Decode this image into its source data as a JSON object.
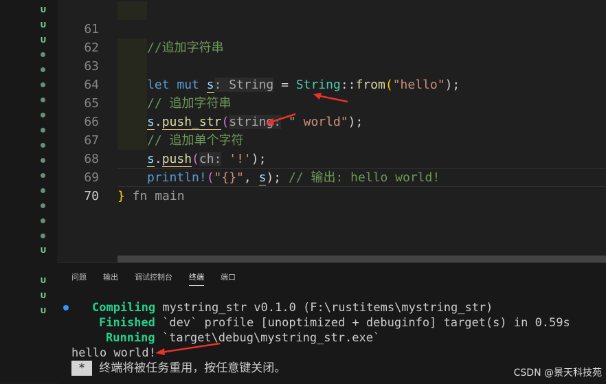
{
  "editor": {
    "lines": [
      {
        "num": "61",
        "comment": "//追加字符串"
      },
      {
        "num": "62"
      },
      {
        "num": "63",
        "kw_let": "let",
        "kw_mut": "mut",
        "var": "s",
        "hint": ": String",
        "eq": " = ",
        "ty": "String",
        "sep": "::",
        "fn": "from",
        "open": "(",
        "str": "\"hello\"",
        "close": ");"
      },
      {
        "num": "64",
        "comment": "// 追加字符串"
      },
      {
        "num": "65",
        "var": "s",
        "dot": ".",
        "fn": "push_str",
        "open": "(",
        "hint": "string:",
        "str": " \" world\"",
        "close": ");"
      },
      {
        "num": "66",
        "comment": "// 追加单个字符"
      },
      {
        "num": "67",
        "var": "s",
        "dot": ".",
        "fn": "push",
        "open": "(",
        "hint": "ch:",
        "str": " '!'",
        "close": ");"
      },
      {
        "num": "68",
        "mac": "println!",
        "open": "(",
        "str": "\"{}\"",
        "comma": ", ",
        "var": "s",
        "close": ");",
        "comment": " // 输出: hello world!"
      },
      {
        "num": "69",
        "brace": "}",
        "ghost": " fn main"
      },
      {
        "num": "70"
      }
    ]
  },
  "gutter": {
    "marks": [
      "U",
      "U",
      "U",
      "U",
      "U",
      "U",
      "U"
    ]
  },
  "panel": {
    "tabs": [
      "问题",
      "输出",
      "调试控制台",
      "终端",
      "端口"
    ],
    "active_tab": "终端"
  },
  "terminal": {
    "compiling_label": "Compiling",
    "compiling_text": " mystring_str v0.1.0 (F:\\rustitems\\mystring_str)",
    "finished_label": "Finished",
    "finished_text": " `dev` profile [unoptimized + debuginfo] target(s) in 0.59s",
    "running_label": "Running",
    "running_text": " `target\\debug\\mystring_str.exe`",
    "output": "hello world!",
    "star": "*",
    "reuse_message": " 终端将被任务重用，按任意键关闭。"
  },
  "watermark": "CSDN @景天科技苑",
  "colors": {
    "background": "#1f1f1f",
    "keyword": "#569cd6",
    "variable": "#9cdcfe",
    "type": "#4ec9b0",
    "function": "#dcdcaa",
    "string": "#ce9178",
    "comment": "#6a9955",
    "terminal_green": "#23d18b",
    "annotation_arrow": "#e8322a"
  }
}
